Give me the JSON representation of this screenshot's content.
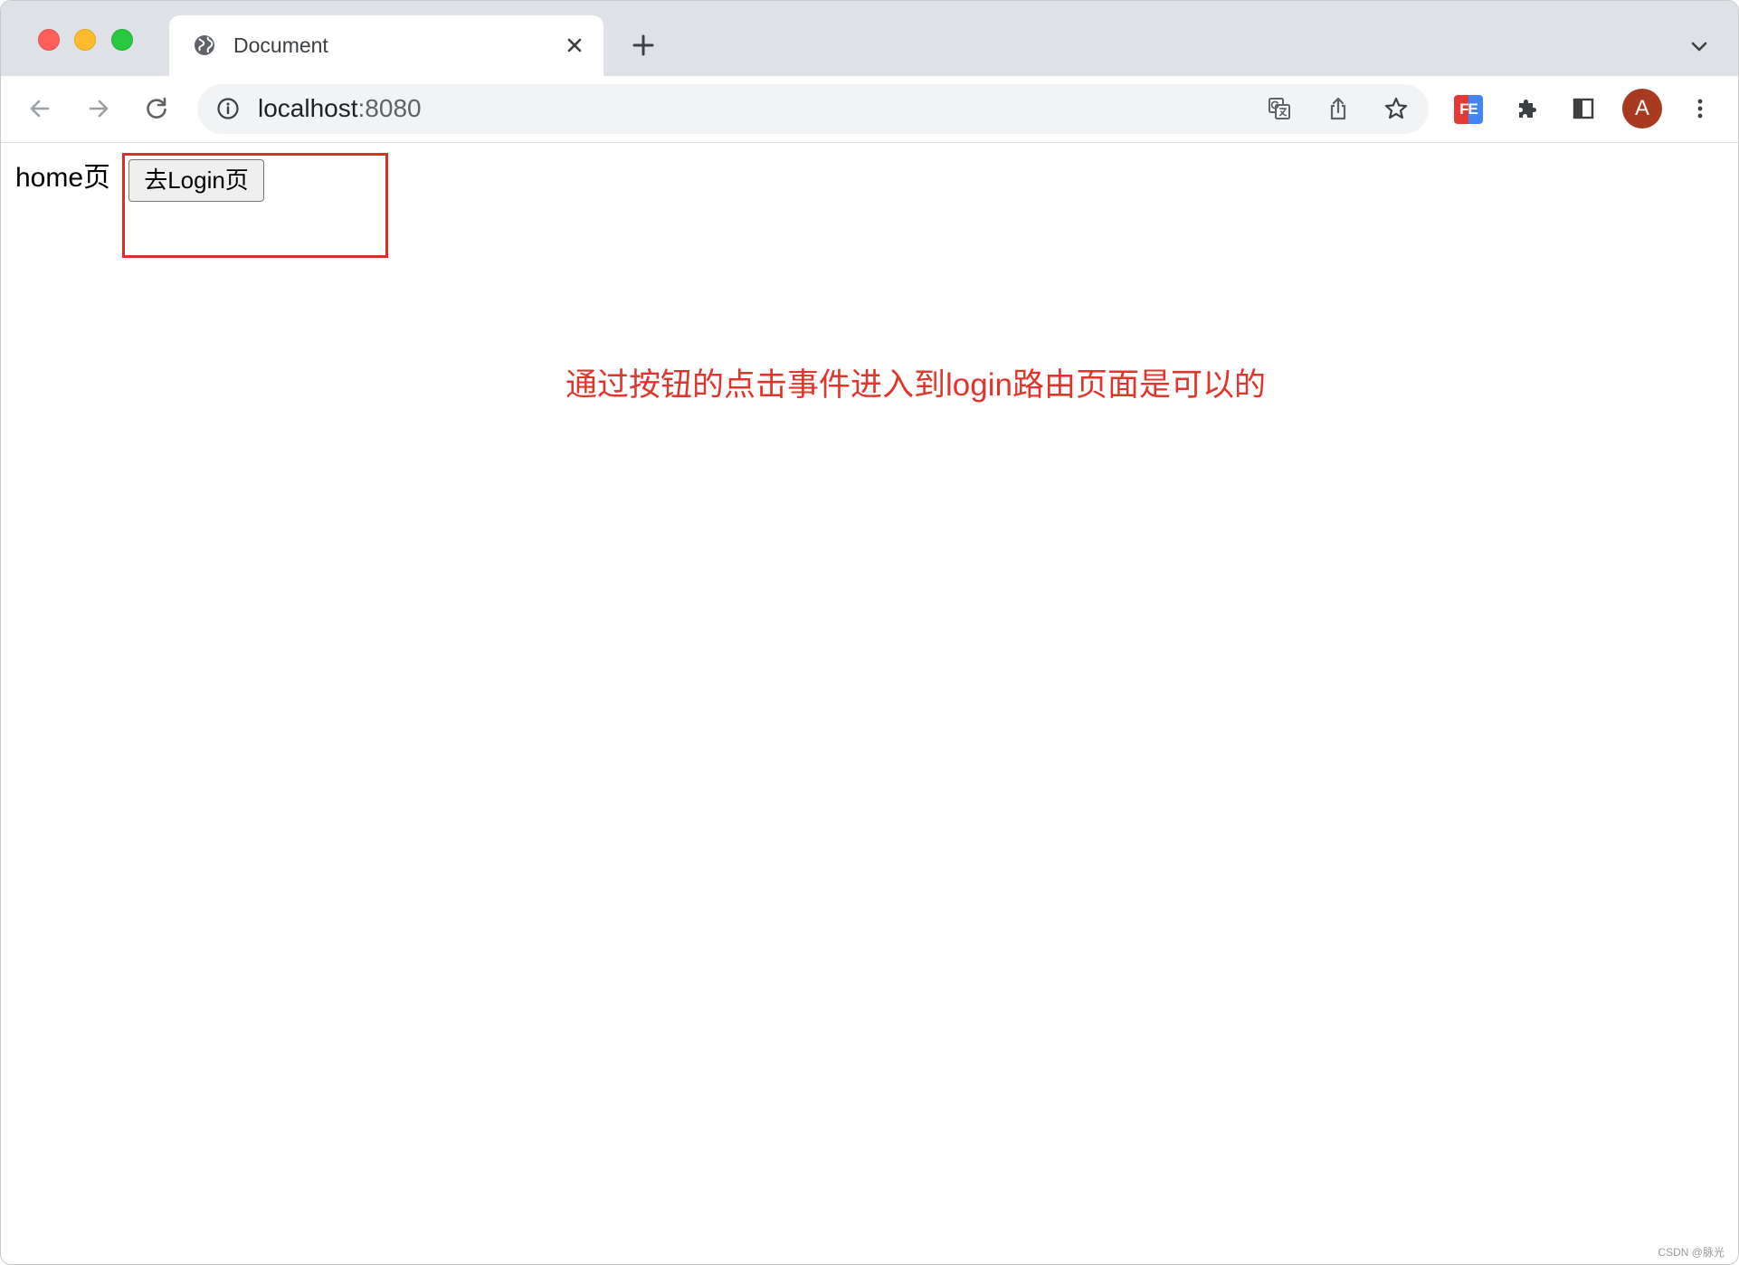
{
  "window": {
    "controls": [
      {
        "name": "close",
        "color": "#ff5f57"
      },
      {
        "name": "minimize",
        "color": "#febc2e"
      },
      {
        "name": "maximize",
        "color": "#28c840"
      }
    ]
  },
  "tabs": [
    {
      "title": "Document",
      "icon": "globe-icon",
      "close_icon": "close-icon"
    }
  ],
  "tab_strip": {
    "new_tab_icon": "plus-icon",
    "tab_search_icon": "chevron-down-icon"
  },
  "toolbar": {
    "back_icon": "arrow-left-icon",
    "forward_icon": "arrow-right-icon",
    "reload_icon": "reload-icon",
    "url": {
      "host": "localhost",
      "port": ":8080",
      "site_info_icon": "info-icon"
    },
    "url_actions": [
      "translate-icon",
      "share-icon",
      "star-icon"
    ],
    "extensions": [
      {
        "label": "FE",
        "icon": "fe-helper-icon"
      },
      {
        "icon": "puzzle-icon"
      }
    ],
    "side_panel_icon": "side-panel-icon",
    "avatar_initial": "A",
    "menu_icon": "kebab-menu-icon"
  },
  "page": {
    "heading": "home页",
    "button_label": "去Login页",
    "annotation": "通过按钮的点击事件进入到login路由页面是可以的"
  },
  "watermark": "CSDN @脉光",
  "colors": {
    "tab_strip_bg": "#dee1e6",
    "url_bar_bg": "#f1f3f4",
    "avatar_bg": "#a83a22",
    "highlight_box": "#d93025",
    "annotation_text": "#e0352b",
    "fe_left": "#e53935",
    "fe_right": "#4285f4"
  }
}
